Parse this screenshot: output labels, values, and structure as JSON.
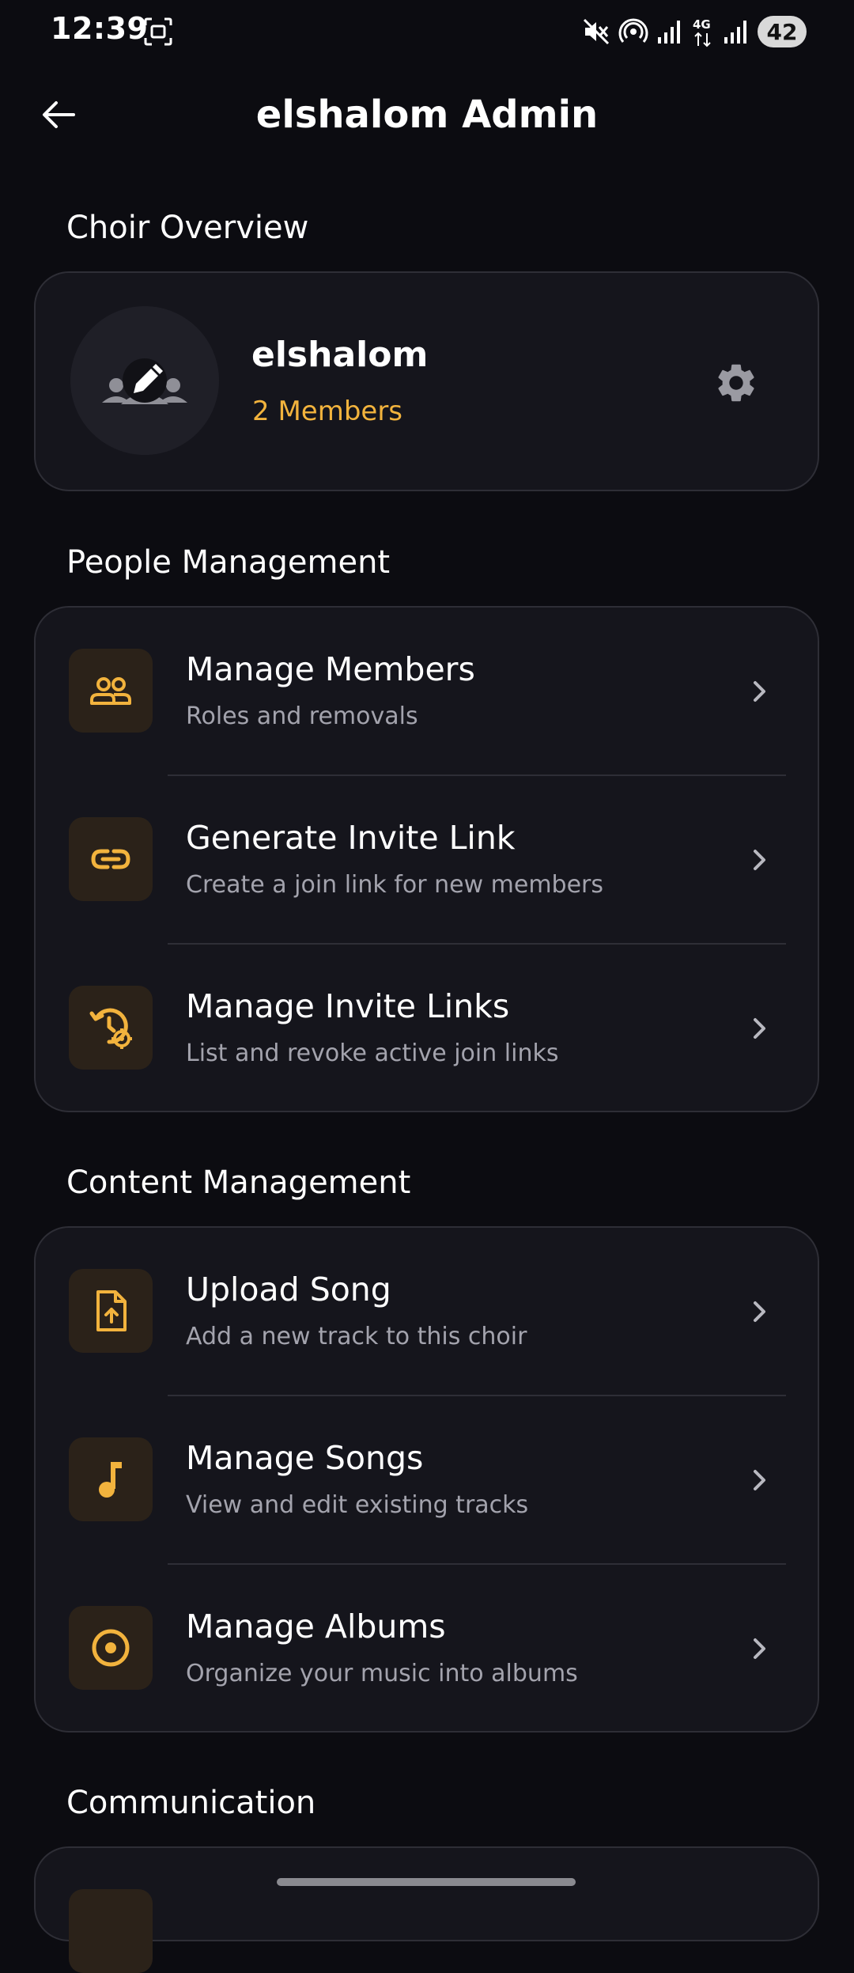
{
  "status_bar": {
    "time": "12:39",
    "battery": "42",
    "network_label": "4G"
  },
  "app_bar": {
    "title": "elshalom Admin"
  },
  "choir_overview": {
    "section_title": "Choir Overview",
    "choir_name": "elshalom",
    "members_label": "2 Members"
  },
  "people_management": {
    "section_title": "People Management",
    "items": [
      {
        "icon": "members-icon",
        "title": "Manage Members",
        "subtitle": "Roles and removals"
      },
      {
        "icon": "link-icon",
        "title": "Generate Invite Link",
        "subtitle": "Create a join link for new members"
      },
      {
        "icon": "history-settings-icon",
        "title": "Manage Invite Links",
        "subtitle": "List and revoke active join links"
      }
    ]
  },
  "content_management": {
    "section_title": "Content Management",
    "items": [
      {
        "icon": "upload-file-icon",
        "title": "Upload Song",
        "subtitle": "Add a new track to this choir"
      },
      {
        "icon": "music-note-icon",
        "title": "Manage Songs",
        "subtitle": "View and edit existing tracks"
      },
      {
        "icon": "album-icon",
        "title": "Manage Albums",
        "subtitle": "Organize your music into albums"
      }
    ]
  },
  "communication": {
    "section_title": "Communication"
  },
  "colors": {
    "background": "#0c0c11",
    "card": "#15151c",
    "card_border": "#2e2e36",
    "accent": "#f2b33d",
    "icon_tile": "#2b2219",
    "subtitle": "#a3a3ad"
  }
}
